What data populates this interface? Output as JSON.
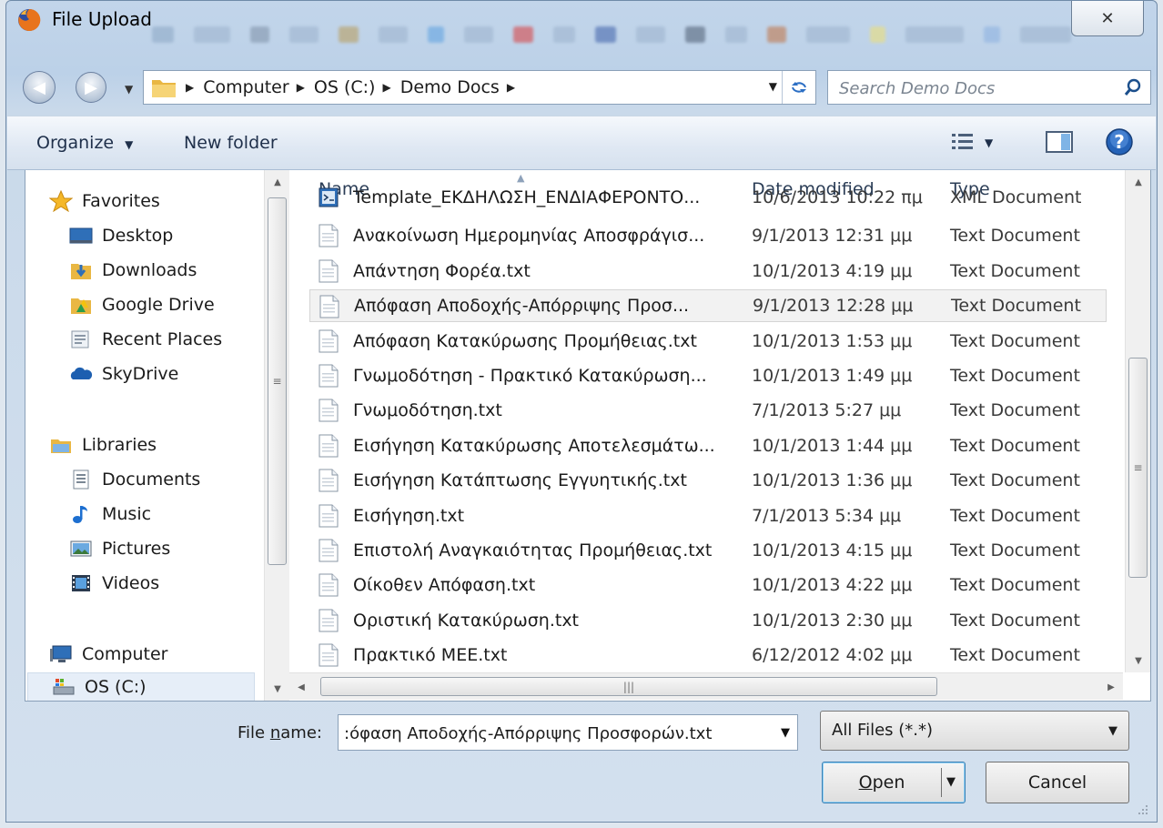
{
  "window": {
    "title": "File Upload",
    "close_glyph": "✕"
  },
  "address": {
    "crumbs": [
      "Computer",
      "OS (C:)",
      "Demo Docs"
    ],
    "search_placeholder": "Search Demo Docs"
  },
  "toolbar": {
    "organize": "Organize",
    "new_folder": "New folder"
  },
  "nav": {
    "favorites": "Favorites",
    "favorites_items": [
      "Desktop",
      "Downloads",
      "Google Drive",
      "Recent Places",
      "SkyDrive"
    ],
    "libraries": "Libraries",
    "libraries_items": [
      "Documents",
      "Music",
      "Pictures",
      "Videos"
    ],
    "computer": "Computer",
    "computer_items": [
      "OS (C:)"
    ]
  },
  "columns": {
    "name": "Name",
    "date": "Date modified",
    "type": "Type"
  },
  "files": [
    {
      "name": "Template_ΕΚΔΗΛΩΣΗ_ΕΝΔΙΑΦΕΡΟΝΤΟ...",
      "date": "10/6/2013 10:22 πμ",
      "type": "XML Document",
      "icon": "xml-document-icon"
    },
    {
      "name": "Ανακοίνωση Ημερομηνίας Αποσφράγισ...",
      "date": "9/1/2013 12:31 μμ",
      "type": "Text Document",
      "icon": "text-document-icon"
    },
    {
      "name": "Απάντηση Φορέα.txt",
      "date": "10/1/2013 4:19 μμ",
      "type": "Text Document",
      "icon": "text-document-icon"
    },
    {
      "name": "Απόφαση Αποδοχής-Απόρριψης Προσ...",
      "date": "9/1/2013 12:28 μμ",
      "type": "Text Document",
      "icon": "text-document-icon",
      "selected": true
    },
    {
      "name": "Απόφαση Κατακύρωσης Προμήθειας.txt",
      "date": "10/1/2013 1:53 μμ",
      "type": "Text Document",
      "icon": "text-document-icon"
    },
    {
      "name": "Γνωμοδότηση - Πρακτικό Κατακύρωση...",
      "date": "10/1/2013 1:49 μμ",
      "type": "Text Document",
      "icon": "text-document-icon"
    },
    {
      "name": "Γνωμοδότηση.txt",
      "date": "7/1/2013 5:27 μμ",
      "type": "Text Document",
      "icon": "text-document-icon"
    },
    {
      "name": "Εισήγηση Κατακύρωσης Αποτελεσμάτω...",
      "date": "10/1/2013 1:44 μμ",
      "type": "Text Document",
      "icon": "text-document-icon"
    },
    {
      "name": "Εισήγηση Κατάπτωσης Εγγυητικής.txt",
      "date": "10/1/2013 1:36 μμ",
      "type": "Text Document",
      "icon": "text-document-icon"
    },
    {
      "name": "Εισήγηση.txt",
      "date": "7/1/2013 5:34 μμ",
      "type": "Text Document",
      "icon": "text-document-icon"
    },
    {
      "name": "Επιστολή Αναγκαιότητας Προμήθειας.txt",
      "date": "10/1/2013 4:15 μμ",
      "type": "Text Document",
      "icon": "text-document-icon"
    },
    {
      "name": "Οίκοθεν Απόφαση.txt",
      "date": "10/1/2013 4:22 μμ",
      "type": "Text Document",
      "icon": "text-document-icon"
    },
    {
      "name": "Οριστική Κατακύρωση.txt",
      "date": "10/1/2013 2:30 μμ",
      "type": "Text Document",
      "icon": "text-document-icon"
    },
    {
      "name": "Πρακτικό ΜΕΕ.txt",
      "date": "6/12/2012 4:02 μμ",
      "type": "Text Document",
      "icon": "text-document-icon"
    }
  ],
  "bottom": {
    "file_name_label_prefix": "File ",
    "file_name_label_accel": "n",
    "file_name_label_suffix": "ame:",
    "file_name_value": ":όφαση Αποδοχής-Απόρριψης Προσφορών.txt",
    "file_type_selected": "All Files (*.*)",
    "open_accel": "O",
    "open_rest": "pen",
    "cancel": "Cancel"
  },
  "colors": {
    "accent": "#2c6fc4",
    "selection": "#f2f2f2",
    "frame": "#bcd1e8"
  }
}
